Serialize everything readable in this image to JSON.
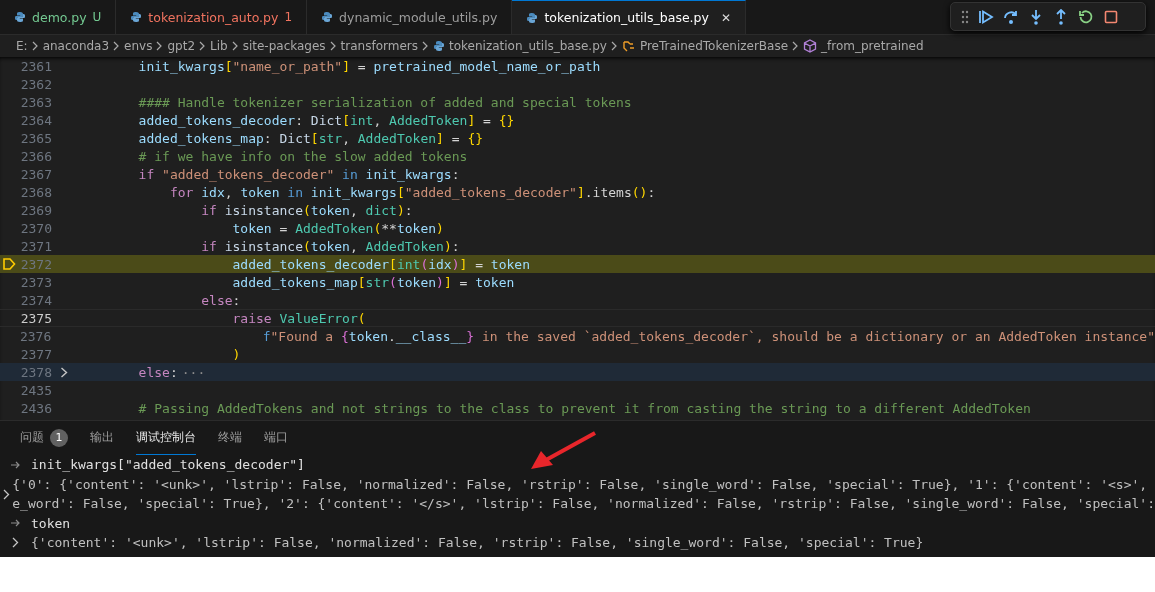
{
  "tabs": [
    {
      "label": "demo.py",
      "kind": "untracked",
      "badge": "U",
      "selected": false
    },
    {
      "label": "tokenization_auto.py",
      "kind": "error",
      "badge": "1",
      "selected": false
    },
    {
      "label": "dynamic_module_utils.py",
      "kind": "plain",
      "selected": false
    },
    {
      "label": "tokenization_utils_base.py",
      "kind": "plain",
      "selected": true,
      "close": "✕"
    }
  ],
  "breadcrumb": [
    {
      "label": "E:",
      "kind": "folder"
    },
    {
      "label": "anaconda3",
      "kind": "folder"
    },
    {
      "label": "envs",
      "kind": "folder"
    },
    {
      "label": "gpt2",
      "kind": "folder"
    },
    {
      "label": "Lib",
      "kind": "folder"
    },
    {
      "label": "site-packages",
      "kind": "folder"
    },
    {
      "label": "transformers",
      "kind": "folder"
    },
    {
      "label": "tokenization_utils_base.py",
      "kind": "file"
    },
    {
      "label": "PreTrainedTokenizerBase",
      "kind": "class"
    },
    {
      "label": "_from_pretrained",
      "kind": "method"
    }
  ],
  "editor": {
    "lines": [
      {
        "number": "2361",
        "paused": false,
        "folded": false,
        "cursor": false,
        "code": [
          {
            "text": "        init_kwargs",
            "kind": "variable"
          },
          {
            "text": "[",
            "kind": "bracket"
          },
          {
            "text": "\"name_or_path\"",
            "kind": "string"
          },
          {
            "text": "]",
            "kind": "bracket"
          },
          {
            "text": " = ",
            "kind": "plain"
          },
          {
            "text": "pretrained_model_name_or_path",
            "kind": "variable"
          }
        ]
      },
      {
        "number": "2362",
        "paused": false,
        "folded": false,
        "cursor": false
      },
      {
        "number": "2363",
        "paused": false,
        "folded": false,
        "cursor": false,
        "code": [
          {
            "text": "        #### Handle tokenizer serialization of added and special tokens",
            "kind": "comment"
          }
        ]
      },
      {
        "number": "2364",
        "paused": false,
        "folded": false,
        "cursor": false,
        "code": [
          {
            "text": "        added_tokens_decoder",
            "kind": "variable"
          },
          {
            "text": ": ",
            "kind": "plain"
          },
          {
            "text": "Dict",
            "kind": "builtin"
          },
          {
            "text": "[",
            "kind": "bracket"
          },
          {
            "text": "int",
            "kind": "type"
          },
          {
            "text": ", ",
            "kind": "plain"
          },
          {
            "text": "AddedToken",
            "kind": "type"
          },
          {
            "text": "]",
            "kind": "bracket"
          },
          {
            "text": " = ",
            "kind": "plain"
          },
          {
            "text": "{}",
            "kind": "bracket"
          }
        ]
      },
      {
        "number": "2365",
        "paused": false,
        "folded": false,
        "cursor": false,
        "code": [
          {
            "text": "        added_tokens_map",
            "kind": "variable"
          },
          {
            "text": ": ",
            "kind": "plain"
          },
          {
            "text": "Dict",
            "kind": "builtin"
          },
          {
            "text": "[",
            "kind": "bracket"
          },
          {
            "text": "str",
            "kind": "type"
          },
          {
            "text": ", ",
            "kind": "plain"
          },
          {
            "text": "AddedToken",
            "kind": "type"
          },
          {
            "text": "]",
            "kind": "bracket"
          },
          {
            "text": " = ",
            "kind": "plain"
          },
          {
            "text": "{}",
            "kind": "bracket"
          }
        ]
      },
      {
        "number": "2366",
        "paused": false,
        "folded": false,
        "cursor": false,
        "code": [
          {
            "text": "        # if we have info on the slow added tokens",
            "kind": "comment"
          }
        ]
      },
      {
        "number": "2367",
        "paused": false,
        "folded": false,
        "cursor": false,
        "code": [
          {
            "text": "        if",
            "kind": "control"
          },
          {
            "text": " \"added_tokens_decoder\"",
            "kind": "string"
          },
          {
            "text": " in",
            "kind": "keyword"
          },
          {
            "text": " init_kwargs",
            "kind": "variable"
          },
          {
            "text": ":",
            "kind": "plain"
          }
        ]
      },
      {
        "number": "2368",
        "paused": false,
        "folded": false,
        "cursor": false,
        "code": [
          {
            "text": "            for",
            "kind": "control"
          },
          {
            "text": " idx",
            "kind": "variable"
          },
          {
            "text": ", ",
            "kind": "plain"
          },
          {
            "text": "token",
            "kind": "variable"
          },
          {
            "text": " in",
            "kind": "keyword"
          },
          {
            "text": " init_kwargs",
            "kind": "variable"
          },
          {
            "text": "[",
            "kind": "bracket"
          },
          {
            "text": "\"added_tokens_decoder\"",
            "kind": "string"
          },
          {
            "text": "]",
            "kind": "bracket"
          },
          {
            "text": ".items",
            "kind": "plain"
          },
          {
            "text": "()",
            "kind": "bracket"
          },
          {
            "text": ":",
            "kind": "plain"
          }
        ]
      },
      {
        "number": "2369",
        "paused": false,
        "folded": false,
        "cursor": false,
        "code": [
          {
            "text": "                if",
            "kind": "control"
          },
          {
            "text": " isinstance",
            "kind": "builtin"
          },
          {
            "text": "(",
            "kind": "bracket"
          },
          {
            "text": "token",
            "kind": "variable"
          },
          {
            "text": ", ",
            "kind": "plain"
          },
          {
            "text": "dict",
            "kind": "type"
          },
          {
            "text": ")",
            "kind": "bracket"
          },
          {
            "text": ":",
            "kind": "plain"
          }
        ]
      },
      {
        "number": "2370",
        "paused": false,
        "folded": false,
        "cursor": false,
        "code": [
          {
            "text": "                    token",
            "kind": "variable"
          },
          {
            "text": " = ",
            "kind": "plain"
          },
          {
            "text": "AddedToken",
            "kind": "type"
          },
          {
            "text": "(",
            "kind": "bracket"
          },
          {
            "text": "**",
            "kind": "plain"
          },
          {
            "text": "token",
            "kind": "variable"
          },
          {
            "text": ")",
            "kind": "bracket"
          }
        ]
      },
      {
        "number": "2371",
        "paused": false,
        "folded": false,
        "cursor": false,
        "code": [
          {
            "text": "                if",
            "kind": "control"
          },
          {
            "text": " isinstance",
            "kind": "builtin"
          },
          {
            "text": "(",
            "kind": "bracket"
          },
          {
            "text": "token",
            "kind": "variable"
          },
          {
            "text": ", ",
            "kind": "plain"
          },
          {
            "text": "AddedToken",
            "kind": "type"
          },
          {
            "text": ")",
            "kind": "bracket"
          },
          {
            "text": ":",
            "kind": "plain"
          }
        ]
      },
      {
        "number": "2372",
        "paused": true,
        "folded": false,
        "cursor": false,
        "code": [
          {
            "text": "                    added_tokens_decoder",
            "kind": "variable"
          },
          {
            "text": "[",
            "kind": "bracket"
          },
          {
            "text": "int",
            "kind": "type"
          },
          {
            "text": "(",
            "kind": "bracket2"
          },
          {
            "text": "idx",
            "kind": "variable"
          },
          {
            "text": ")",
            "kind": "bracket2"
          },
          {
            "text": "]",
            "kind": "bracket"
          },
          {
            "text": " = ",
            "kind": "plain"
          },
          {
            "text": "token",
            "kind": "variable"
          }
        ]
      },
      {
        "number": "2373",
        "paused": false,
        "folded": false,
        "cursor": false,
        "code": [
          {
            "text": "                    added_tokens_map",
            "kind": "variable"
          },
          {
            "text": "[",
            "kind": "bracket"
          },
          {
            "text": "str",
            "kind": "type"
          },
          {
            "text": "(",
            "kind": "bracket2"
          },
          {
            "text": "token",
            "kind": "variable"
          },
          {
            "text": ")",
            "kind": "bracket2"
          },
          {
            "text": "]",
            "kind": "bracket"
          },
          {
            "text": " = ",
            "kind": "plain"
          },
          {
            "text": "token",
            "kind": "variable"
          }
        ]
      },
      {
        "number": "2374",
        "paused": false,
        "folded": false,
        "cursor": false,
        "code": [
          {
            "text": "                else",
            "kind": "control"
          },
          {
            "text": ":",
            "kind": "plain"
          }
        ]
      },
      {
        "number": "2375",
        "paused": false,
        "folded": false,
        "cursor": true,
        "code": [
          {
            "text": "                    raise",
            "kind": "control"
          },
          {
            "text": " ValueError",
            "kind": "type"
          },
          {
            "text": "(",
            "kind": "bracket"
          }
        ]
      },
      {
        "number": "2376",
        "paused": false,
        "folded": false,
        "cursor": false,
        "code": [
          {
            "text": "                        f",
            "kind": "keyword"
          },
          {
            "text": "\"Found a ",
            "kind": "string"
          },
          {
            "text": "{",
            "kind": "bracket2"
          },
          {
            "text": "token",
            "kind": "variable"
          },
          {
            "text": ".",
            "kind": "plain"
          },
          {
            "text": "__class__",
            "kind": "variable"
          },
          {
            "text": "}",
            "kind": "bracket2"
          },
          {
            "text": " in the saved `added_tokens_decoder`, should be a dictionary or an AddedToken instance\"",
            "kind": "string"
          }
        ]
      },
      {
        "number": "2377",
        "paused": false,
        "folded": false,
        "cursor": false,
        "code": [
          {
            "text": "                    )",
            "kind": "bracket"
          }
        ]
      },
      {
        "number": "2378",
        "paused": false,
        "folded": true,
        "cursor": false,
        "code": [
          {
            "text": "        else",
            "kind": "control"
          },
          {
            "text": ":",
            "kind": "plain"
          }
        ],
        "fold_ellipsis": "···"
      },
      {
        "number": "2435",
        "paused": false,
        "folded": false,
        "cursor": false
      },
      {
        "number": "2436",
        "paused": false,
        "folded": false,
        "cursor": false,
        "code": [
          {
            "text": "        # Passing AddedTokens and not strings to the class to prevent it from casting the string to a different AddedToken",
            "kind": "comment"
          }
        ]
      }
    ]
  },
  "panel": {
    "tabs": [
      {
        "label": "问题",
        "badge": "1",
        "selected": false
      },
      {
        "label": "输出",
        "selected": false
      },
      {
        "label": "调试控制台",
        "selected": true
      },
      {
        "label": "终端",
        "selected": false
      },
      {
        "label": "端口",
        "selected": false
      }
    ],
    "console": [
      {
        "kind": "input",
        "lines": [
          "init_kwargs[\"added_tokens_decoder\"]"
        ]
      },
      {
        "kind": "output",
        "lines": [
          "{'0': {'content': '<unk>', 'lstrip': False, 'normalized': False, 'rstrip': False, 'single_word': False, 'special': True}, '1': {'content': '<s>',",
          "e_word': False, 'special': True}, '2': {'content': '</s>', 'lstrip': False, 'normalized': False, 'rstrip': False, 'single_word': False, 'special':"
        ]
      },
      {
        "kind": "input",
        "lines": [
          "token"
        ]
      },
      {
        "kind": "output",
        "lines": [
          "{'content': '<unk>', 'lstrip': False, 'normalized': False, 'rstrip': False, 'single_word': False, 'special': True}"
        ]
      }
    ]
  }
}
